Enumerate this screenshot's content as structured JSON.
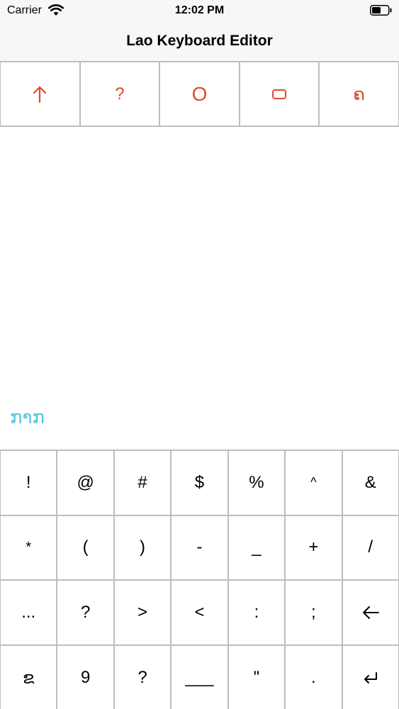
{
  "status_bar": {
    "carrier": "Carrier",
    "time": "12:02 PM",
    "icons": [
      "wifi-icon",
      "battery-icon"
    ]
  },
  "nav": {
    "title": "Lao Keyboard Editor"
  },
  "toolbar": {
    "accent_color": "#e0472f",
    "buttons": [
      {
        "label": "",
        "icon": "arrow-up-icon"
      },
      {
        "label": "?",
        "icon": ""
      },
      {
        "label": "O",
        "icon": ""
      },
      {
        "label": "",
        "icon": "rounded-rect-icon"
      },
      {
        "label": "ຄ",
        "icon": ""
      }
    ]
  },
  "editor": {
    "text": "ກາກ",
    "text_color": "#5bc0de"
  },
  "keyboard": {
    "rows": [
      [
        "!",
        "@",
        "#",
        "$",
        "%",
        "^",
        "&"
      ],
      [
        "*",
        "(",
        ")",
        "-",
        "_",
        "+",
        "/"
      ],
      [
        "...",
        "?",
        ">",
        "<",
        ":",
        ";",
        ""
      ],
      [
        "ຂ",
        "9",
        "?",
        "___",
        "\"",
        ".",
        ""
      ]
    ],
    "icon_keys": {
      "backspace": "arrow-left-icon",
      "return": "return-icon"
    }
  }
}
